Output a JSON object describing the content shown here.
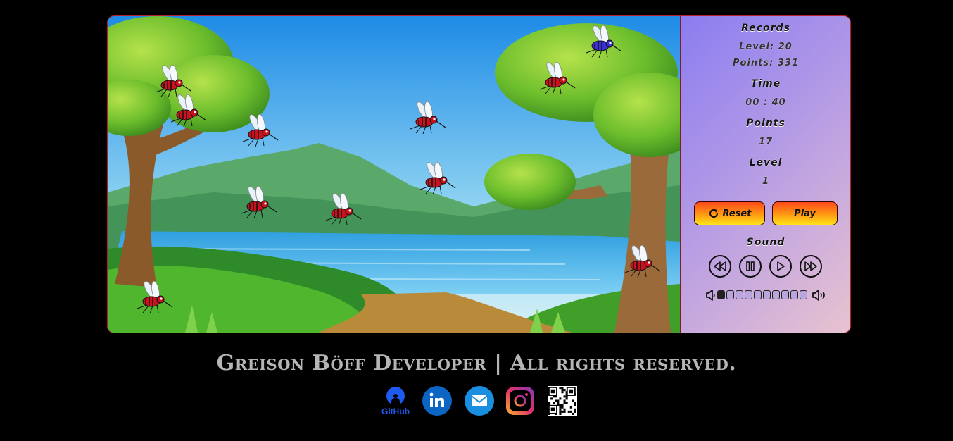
{
  "panel": {
    "records_heading": "Records",
    "records_level": "Level: 20",
    "records_points": "Points: 331",
    "time_heading": "Time",
    "time_value": "00 : 40",
    "points_heading": "Points",
    "points_value": "17",
    "level_heading": "Level",
    "level_value": "1",
    "reset_label": "Reset",
    "play_label": "Play",
    "sound_heading": "Sound",
    "volume_total_segments": 10,
    "volume_filled_segments": 1
  },
  "footer": {
    "text": "Greison Böff Developer | All rights reserved.",
    "github_label": "GitHub"
  },
  "colors": {
    "button_gradient_top": "#ff4a1c",
    "button_gradient_bottom": "#ffe21a",
    "panel_gradient_start": "#8b7df0",
    "panel_gradient_end": "#e9c3d0",
    "linkedin": "#0a66c2",
    "email": "#1a8fe0",
    "footer_text": "#b5b5b5"
  },
  "icons": {
    "reset": "refresh-icon",
    "rewind": "rewind-icon",
    "pause": "pause-icon",
    "play": "play-icon",
    "forward": "fast-forward-icon",
    "volume_low": "volume-low-icon",
    "volume_high": "volume-high-icon",
    "github": "github-icon",
    "linkedin": "linkedin-icon",
    "email": "email-icon",
    "instagram": "instagram-icon",
    "qr": "qr-code-icon"
  },
  "game": {
    "enemy": "mosquito",
    "enemy_count": 11,
    "player": "blue-mosquito"
  }
}
